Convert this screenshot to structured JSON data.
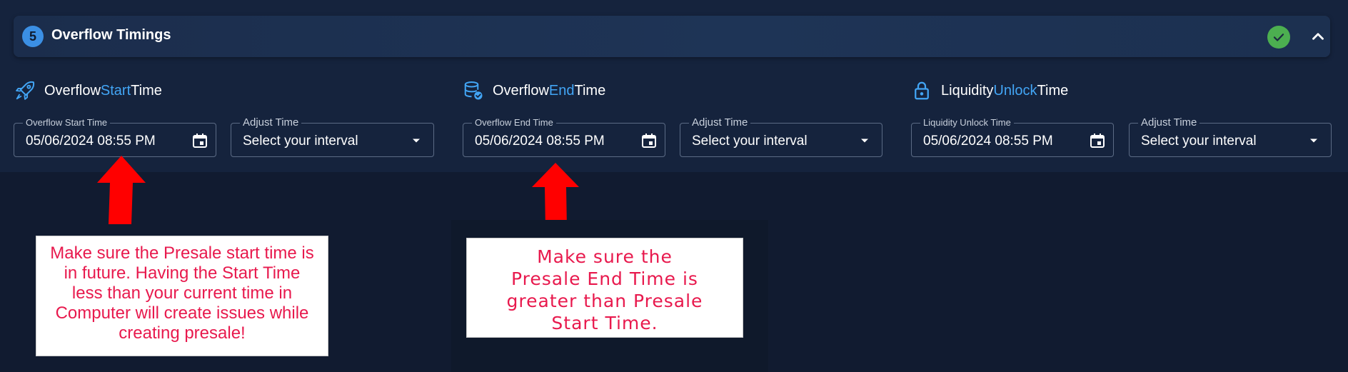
{
  "header": {
    "step_number": "5",
    "title": "Overflow Timings"
  },
  "sections": [
    {
      "title_before": "Overflow ",
      "title_accent": "Start",
      "title_after": " Time",
      "icon": "rocket-icon",
      "date_label": "Overflow Start Time",
      "date_value": "05/06/2024 08:55 PM",
      "adjust_label": "Adjust Time",
      "adjust_value": "Select your interval"
    },
    {
      "title_before": "Overflow ",
      "title_accent": "End",
      "title_after": " Time",
      "icon": "database-check-icon",
      "date_label": "Overflow End Time",
      "date_value": "05/06/2024 08:55 PM",
      "adjust_label": "Adjust Time",
      "adjust_value": "Select your interval"
    },
    {
      "title_before": "Liquidity ",
      "title_accent": "Unlock",
      "title_after": " Time",
      "icon": "lock-icon",
      "date_label": "Liquidity Unlock Time",
      "date_value": "05/06/2024 08:55 PM",
      "adjust_label": "Adjust Time",
      "adjust_value": "Select your interval"
    }
  ],
  "annotations": {
    "note1_lines": [
      "Make sure the Presale start time is",
      "in future. Having the Start Time",
      "less than your current time in",
      "Computer will create issues while",
      "creating presale!"
    ],
    "note2_lines": [
      "Make sure the",
      "Presale End Time is",
      "greater than Presale",
      "Start Time."
    ]
  },
  "colors": {
    "accent": "#42a5f5",
    "success": "#4caf50",
    "annotation_text": "#e8194d",
    "arrow": "#ff0000"
  }
}
